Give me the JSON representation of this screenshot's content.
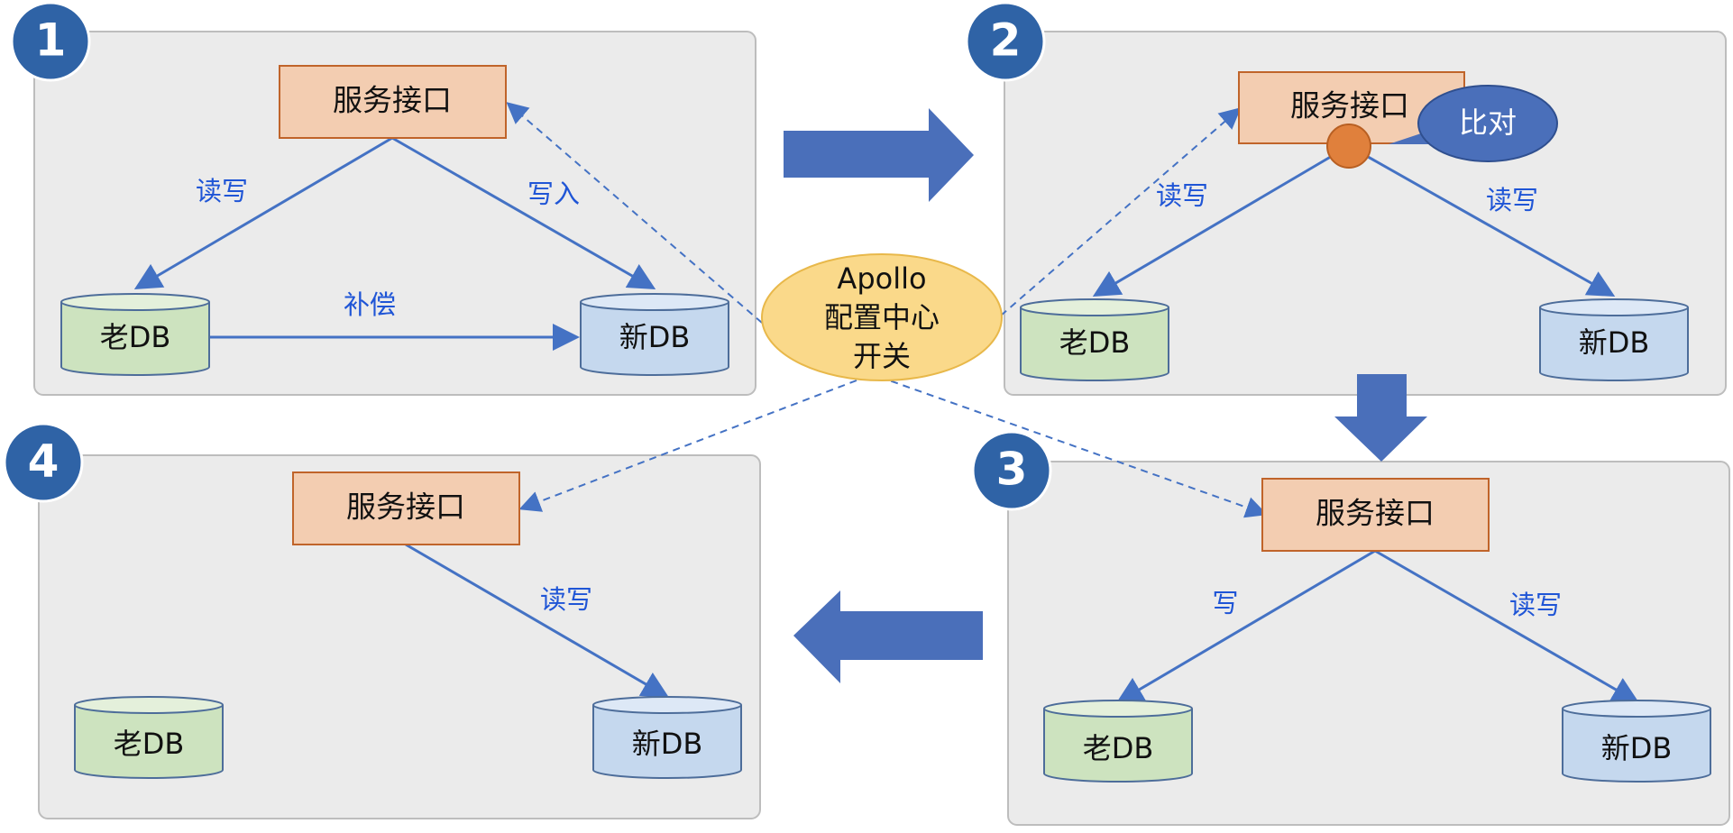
{
  "colors": {
    "panel_fill": "#ebebeb",
    "panel_stroke": "#bdbdbd",
    "badge": "#2f63a6",
    "service_fill": "#f3cdb1",
    "service_stroke": "#c0642a",
    "old_db_fill": "#cde3bf",
    "old_db_top": "#e4f0db",
    "new_db_fill": "#c5d8ee",
    "new_db_top": "#dde8f6",
    "db_stroke": "#4d6d9a",
    "line": "#4472c4",
    "label_text": "#1f55d6",
    "big_arrow": "#4a6fba",
    "apollo_fill": "#fad98a",
    "apollo_stroke": "#e8b84a",
    "compare_fill": "#4a6fba",
    "dot_fill": "#e0803c"
  },
  "panels": [
    {
      "badge": "1",
      "service": "服务接口",
      "old_db": "老DB",
      "new_db": "新DB",
      "left_edge_label": "读写",
      "right_edge_label": "写入",
      "bottom_edge_label": "补偿"
    },
    {
      "badge": "2",
      "service": "服务接口",
      "old_db": "老DB",
      "new_db": "新DB",
      "left_edge_label": "读写",
      "right_edge_label": "读写",
      "compare_bubble": "比对"
    },
    {
      "badge": "3",
      "service": "服务接口",
      "old_db": "老DB",
      "new_db": "新DB",
      "left_edge_label": "写",
      "right_edge_label": "读写"
    },
    {
      "badge": "4",
      "service": "服务接口",
      "old_db": "老DB",
      "new_db": "新DB",
      "right_edge_label": "读写"
    }
  ],
  "apollo": {
    "line1": "Apollo",
    "line2": "配置中心",
    "line3": "开关"
  }
}
